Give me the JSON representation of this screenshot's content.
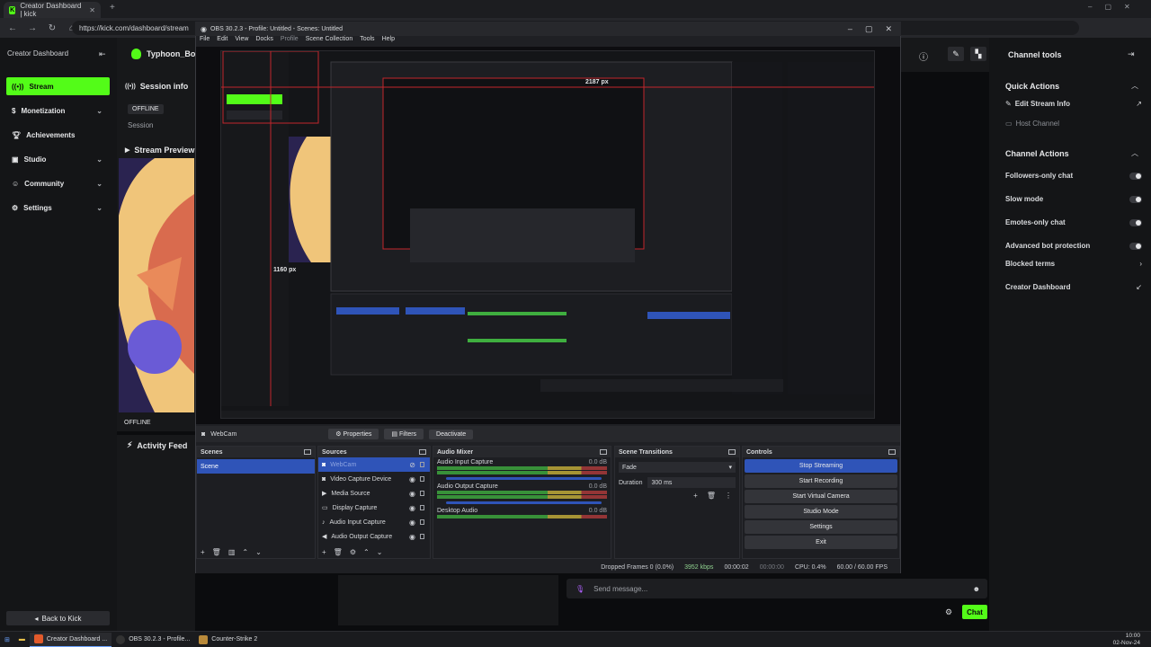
{
  "browser": {
    "tab_title": "Creator Dashboard | kick",
    "url": "https://kick.com/dashboard/stream",
    "favicon": "K"
  },
  "kick": {
    "sidebar_title": "Creator Dashboard",
    "username": "Typhoon_Bob",
    "nav": [
      {
        "label": "Stream",
        "icon": "broadcast-icon",
        "active": true
      },
      {
        "label": "Monetization",
        "icon": "coin-icon"
      },
      {
        "label": "Achievements",
        "icon": "trophy-icon"
      },
      {
        "label": "Studio",
        "icon": "studio-icon"
      },
      {
        "label": "Community",
        "icon": "people-icon"
      },
      {
        "label": "Settings",
        "icon": "gear-icon"
      }
    ],
    "back_label": "Back to Kick",
    "session_info": "Session info",
    "offline_badge": "OFFLINE",
    "session_label": "Session",
    "stream_preview": "Stream Preview",
    "offline_label": "OFFLINE",
    "activity_feed": "Activity Feed",
    "chat_placeholder": "Send message...",
    "chat_button": "Chat",
    "accent": "#53fc18"
  },
  "channel_tools": {
    "title": "Channel tools",
    "quick_actions": "Quick Actions",
    "edit_stream_info": "Edit Stream Info",
    "host_channel": "Host Channel",
    "channel_actions": "Channel Actions",
    "toggles": [
      {
        "label": "Followers-only chat"
      },
      {
        "label": "Slow mode"
      },
      {
        "label": "Emotes-only chat"
      },
      {
        "label": "Advanced bot protection"
      }
    ],
    "blocked_terms": "Blocked terms",
    "creator_dashboard": "Creator Dashboard"
  },
  "obs": {
    "title": "OBS 30.2.3 - Profile: Untitled - Scenes: Untitled",
    "menu": [
      "File",
      "Edit",
      "View",
      "Docks",
      "Profile",
      "Scene Collection",
      "Tools",
      "Help"
    ],
    "source_name": "WebCam",
    "properties_btn": "Properties",
    "filters_btn": "Filters",
    "deactivate_btn": "Deactivate",
    "scenes_title": "Scenes",
    "scene_item": "Scene",
    "sources_title": "Sources",
    "sources": [
      "WebCam",
      "Video Capture Device",
      "Media Source",
      "Display Capture",
      "Audio Input Capture",
      "Audio Output Capture"
    ],
    "mixer_title": "Audio Mixer",
    "mixer": [
      {
        "name": "Audio Input Capture",
        "db": "0.0 dB"
      },
      {
        "name": "Audio Output Capture",
        "db": "0.0 dB"
      },
      {
        "name": "Desktop Audio",
        "db": "0.0 dB"
      }
    ],
    "transitions_title": "Scene Transitions",
    "transition": "Fade",
    "duration_label": "Duration",
    "duration_value": "300 ms",
    "controls_title": "Controls",
    "controls": [
      "Stop Streaming",
      "Start Recording",
      "Start Virtual Camera",
      "Studio Mode",
      "Settings",
      "Exit"
    ],
    "status": {
      "dropped": "Dropped Frames 0 (0.0%)",
      "bitrate": "3952 kbps",
      "stream_time": "00:00:02",
      "rec_time": "00:00:00",
      "cpu": "CPU: 0.4%",
      "fps": "60.00 / 60.00 FPS"
    },
    "measure_h": "2187 px",
    "measure_v": "1160 px"
  },
  "taskbar": {
    "items": [
      "Creator Dashboard ...",
      "OBS 30.2.3 - Profile...",
      "Counter-Strike 2"
    ],
    "time": "10:00",
    "date": "02-Nov-24"
  }
}
